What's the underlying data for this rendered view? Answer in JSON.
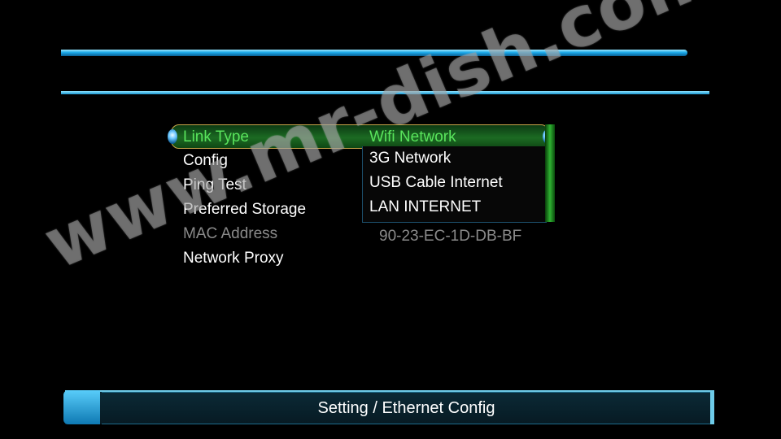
{
  "menu": {
    "items": [
      {
        "label": "Link Type",
        "value": "Wifi Network"
      },
      {
        "label": "Config",
        "value": ""
      },
      {
        "label": "Ping Test",
        "value": ""
      },
      {
        "label": "Preferred Storage",
        "value": ""
      },
      {
        "label": "MAC Address",
        "value": "90-23-EC-1D-DB-BF"
      },
      {
        "label": "Network Proxy",
        "value": ""
      }
    ]
  },
  "dropdown": {
    "options": [
      "3G Network",
      "USB Cable Internet",
      "LAN INTERNET"
    ]
  },
  "footer": {
    "title": "Setting / Ethernet Config"
  },
  "watermark": {
    "text": "www.mr-dish.com"
  },
  "colors": {
    "accent": "#1aa8e8",
    "selected_text": "#59e45c",
    "selection_border": "#c9a64a",
    "disabled_text": "#8a8a8a"
  }
}
